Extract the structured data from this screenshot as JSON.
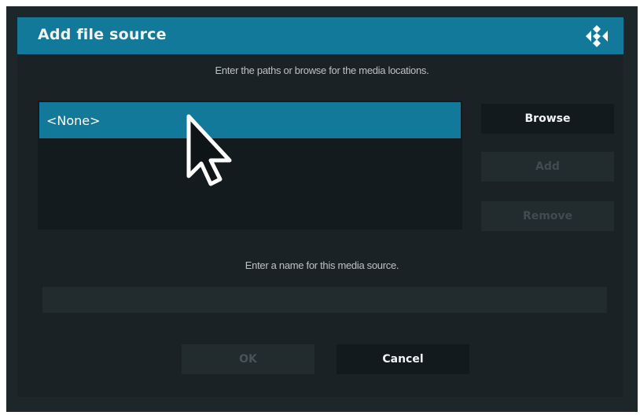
{
  "dialog": {
    "title": "Add file source",
    "logo_icon": "kodi-logo-icon",
    "paths_instruction": "Enter the paths or browse for the media locations.",
    "paths": [
      {
        "label": "<None>",
        "selected": true
      }
    ],
    "buttons": {
      "browse": "Browse",
      "add": "Add",
      "remove": "Remove"
    },
    "name_instruction": "Enter a name for this media source.",
    "name_field": {
      "value": "",
      "placeholder": ""
    },
    "footer": {
      "ok": "OK",
      "cancel": "Cancel"
    }
  },
  "colors": {
    "accent": "#12799a",
    "dialog_bg": "#1d2629",
    "button_bg": "#131a1d",
    "disabled_text": "#414c50"
  },
  "cursor_icon": "mouse-pointer-icon"
}
